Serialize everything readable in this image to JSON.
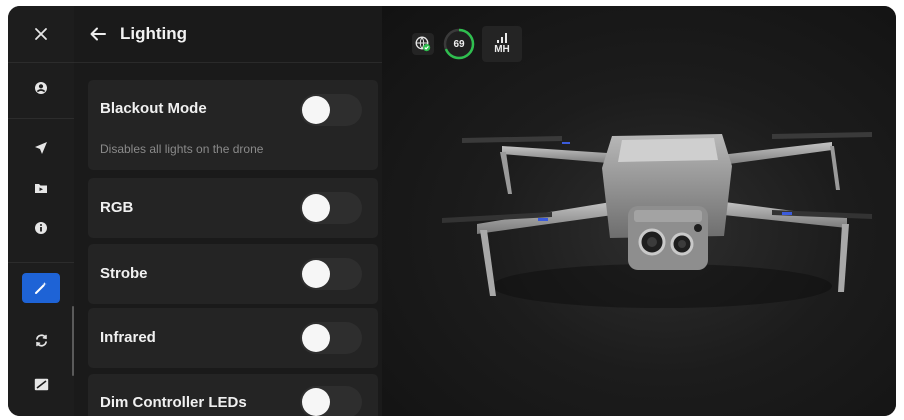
{
  "rail": {
    "close_icon": "close-icon",
    "items": [
      {
        "name": "account",
        "icon": "account-icon"
      },
      {
        "name": "navigation",
        "icon": "navigation-icon"
      },
      {
        "name": "media",
        "icon": "media-icon"
      },
      {
        "name": "info",
        "icon": "info-icon"
      },
      {
        "name": "tools",
        "icon": "wand-icon",
        "active": true
      },
      {
        "name": "sync",
        "icon": "sync-icon"
      },
      {
        "name": "display",
        "icon": "display-icon"
      }
    ]
  },
  "panel": {
    "title": "Lighting",
    "settings": [
      {
        "label": "Blackout Mode",
        "description": "Disables all lights on the drone",
        "enabled": false
      },
      {
        "label": "RGB",
        "enabled": false
      },
      {
        "label": "Strobe",
        "enabled": false
      },
      {
        "label": "Infrared",
        "enabled": false
      },
      {
        "label": "Dim Controller LEDs",
        "enabled": false
      }
    ]
  },
  "status": {
    "battery": "69",
    "signal_label": "MH"
  },
  "colors": {
    "accent": "#1e63d6",
    "battery_green": "#2fbf4f",
    "panel_bg": "#1a1a1a",
    "card_bg": "#242424"
  }
}
